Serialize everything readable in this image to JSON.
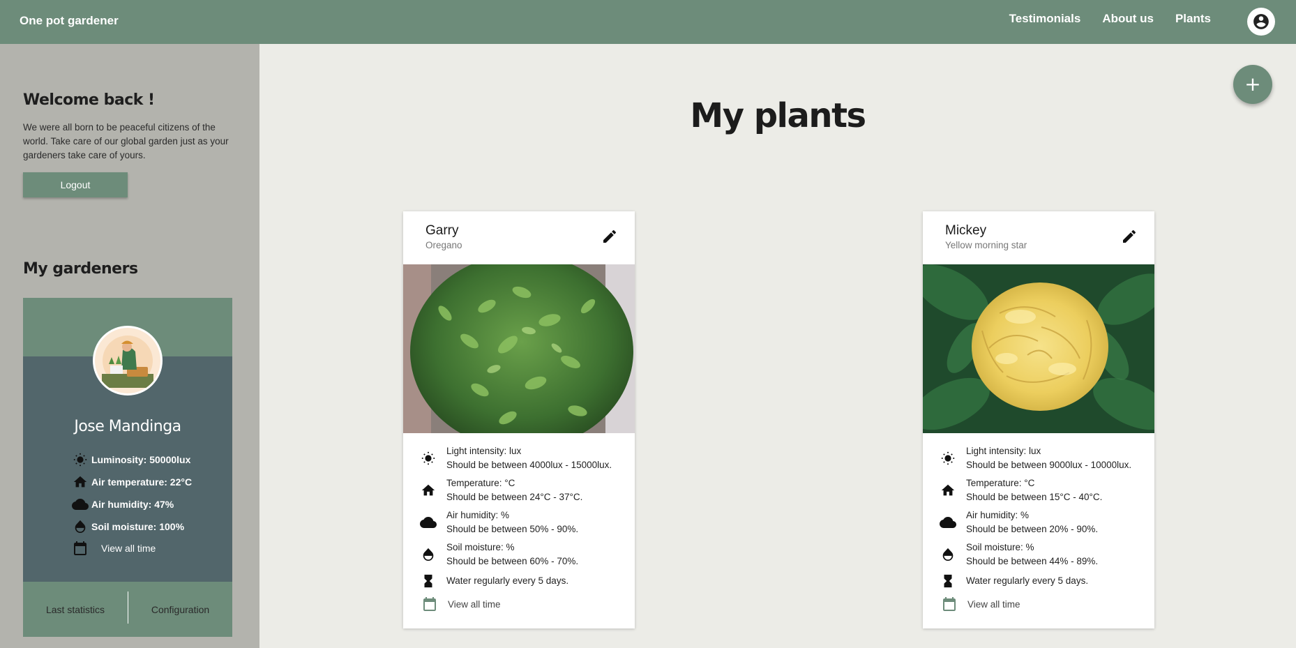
{
  "header": {
    "brand": "One pot gardener",
    "nav": [
      "Testimonials",
      "About us",
      "Plants"
    ]
  },
  "sidebar": {
    "welcome_title": "Welcome back !",
    "welcome_text": "We were all born to be peaceful citizens of the world. Take care of our global garden just as your gardeners take care of yours.",
    "logout_label": "Logout",
    "gardeners_title": "My gardeners",
    "gardener": {
      "name": "Jose Mandinga",
      "stats": [
        "Luminosity: 50000lux",
        "Air temperature: 22°C",
        "Air humidity: 47%",
        "Soil moisture: 100%"
      ],
      "view_all": "View all time",
      "last_statistics": "Last statistics",
      "configuration": "Configuration"
    }
  },
  "main": {
    "title": "My plants",
    "fab_label": "+",
    "plants": [
      {
        "name": "Garry",
        "species": "Oregano",
        "light_1": "Light intensity: lux",
        "light_2": "Should be between 4000lux - 15000lux.",
        "temp_1": "Temperature: °C",
        "temp_2": "Should be between 24°C - 37°C.",
        "hum_1": "Air humidity: %",
        "hum_2": "Should be between 50% - 90%.",
        "soil_1": "Soil moisture: %",
        "soil_2": "Should be between 60% - 70%.",
        "water": "Water regularly every 5 days.",
        "view_all": "View all time"
      },
      {
        "name": "Mickey",
        "species": "Yellow morning star",
        "light_1": "Light intensity: lux",
        "light_2": "Should be between 9000lux - 10000lux.",
        "temp_1": "Temperature: °C",
        "temp_2": "Should be between 15°C - 40°C.",
        "hum_1": "Air humidity: %",
        "hum_2": "Should be between 20% - 90%.",
        "soil_1": "Soil moisture: %",
        "soil_2": "Should be between 44% - 89%.",
        "water": "Water regularly every 5 days.",
        "view_all": "View all time"
      }
    ]
  },
  "colors": {
    "accent": "#6d8c7a",
    "sidebar_bg": "#b3b3ad",
    "card_dark": "#52666b",
    "page_bg": "#ecece7"
  },
  "icons": {
    "luminosity": "sun-icon",
    "temperature": "home-icon",
    "humidity": "cloud-icon",
    "soil": "drop-icon",
    "water": "hourglass-icon",
    "calendar": "calendar-icon",
    "edit": "pencil-icon",
    "account": "account-circle-icon"
  }
}
